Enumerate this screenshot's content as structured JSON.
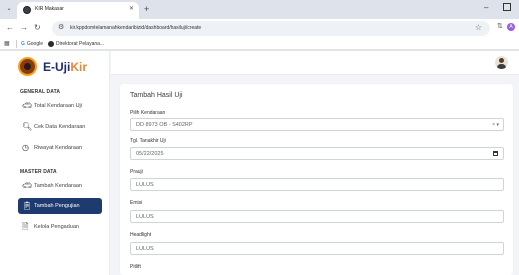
{
  "browser": {
    "tab_title": "KIR Makasar",
    "url": "kir.kppdomtelamanahkendaribizid/dashboard/hasiluji/create",
    "bookmarks": [
      {
        "label": "Google",
        "icon": "G"
      },
      {
        "label": "Direktorat Pelayana..."
      }
    ],
    "profile_initial": "A"
  },
  "app": {
    "logo": {
      "prefix": "E-Uji",
      "highlight": "Kir"
    },
    "sidebar": {
      "sections": [
        {
          "title": "GENERAL DATA",
          "items": [
            {
              "label": "Total Kendaraan Uji",
              "icon": "car-icon"
            },
            {
              "label": "Cek Data Kendaraan",
              "icon": "search-icon"
            },
            {
              "label": "Riwayat Kendaraan",
              "icon": "history-icon"
            }
          ]
        },
        {
          "title": "MASTER DATA",
          "items": [
            {
              "label": "Tambah Kendaraan",
              "icon": "car-icon"
            },
            {
              "label": "Tambah Pengujian",
              "icon": "clipboard-icon",
              "active": true
            },
            {
              "label": "Kelola Pengaduan",
              "icon": "document-icon"
            }
          ]
        }
      ]
    },
    "form": {
      "title": "Tambah Hasil Uji",
      "fields": [
        {
          "label": "Pilih Kendaraan",
          "value": "DD 8973 OB - S402RP",
          "type": "select"
        },
        {
          "label": "Tgl. Tanakhir Uji",
          "value": "05/22/2025",
          "type": "date"
        },
        {
          "label": "Prauji",
          "value": "LULUS",
          "type": "text"
        },
        {
          "label": "Emisi",
          "value": "LULUS",
          "type": "text"
        },
        {
          "label": "Headlight",
          "value": "LULUS",
          "type": "text"
        },
        {
          "label": "Pitlift",
          "value": "",
          "type": "text"
        }
      ]
    },
    "colors": {
      "active_nav": "#1e3a6e",
      "logo_text": "#1f2b6b",
      "logo_highlight": "#e1893a"
    }
  }
}
